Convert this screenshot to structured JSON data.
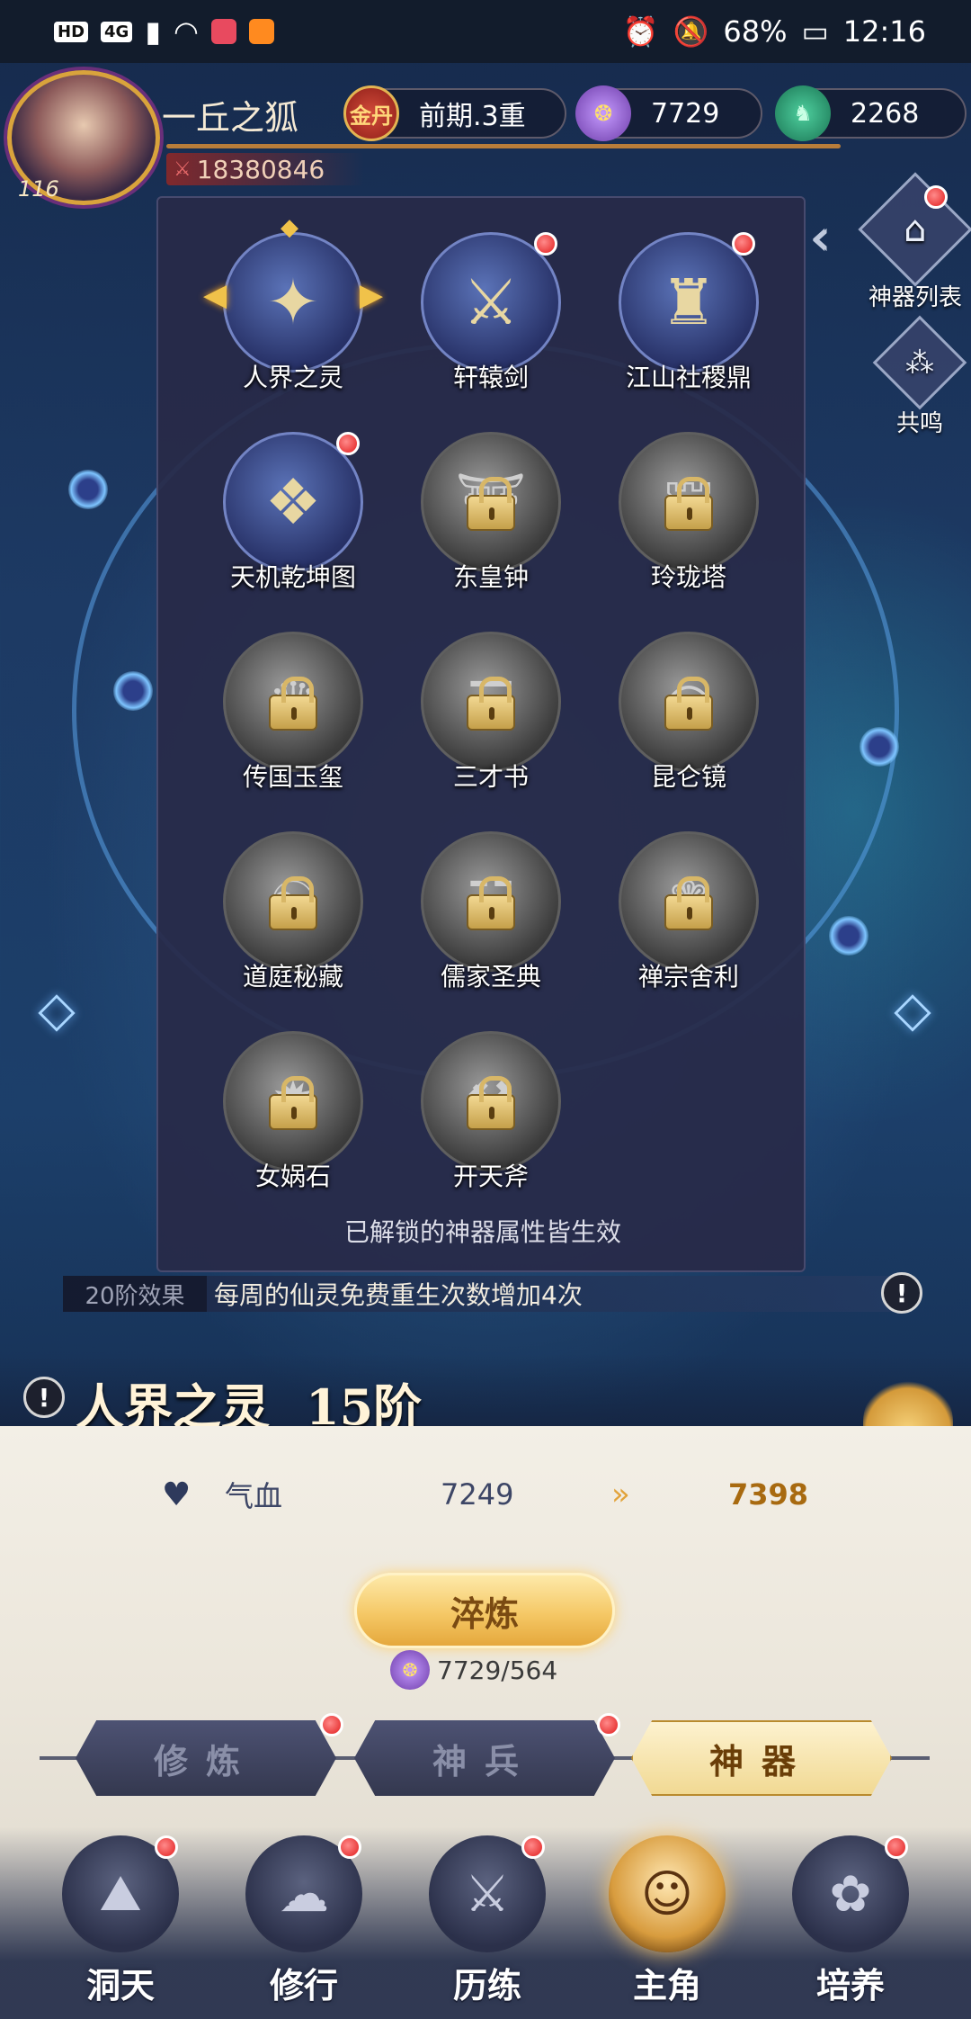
{
  "status_bar": {
    "left_chips": [
      "HD",
      "4G"
    ],
    "battery": "68%",
    "time": "12:16"
  },
  "player": {
    "name": "一丘之狐",
    "level": "116",
    "power": "18380846",
    "realm_badge": "金丹",
    "realm": "前期.3重",
    "currency1": "7729",
    "currency2": "2268"
  },
  "side": {
    "list_label": "神器列表",
    "resonance_label": "共鸣"
  },
  "artifacts": [
    {
      "name": "人界之灵",
      "locked": false,
      "dot": false,
      "selected": true,
      "icon": "✦"
    },
    {
      "name": "轩辕剑",
      "locked": false,
      "dot": true,
      "selected": false,
      "icon": "⚔"
    },
    {
      "name": "江山社稷鼎",
      "locked": false,
      "dot": true,
      "selected": false,
      "icon": "♜"
    },
    {
      "name": "天机乾坤图",
      "locked": false,
      "dot": true,
      "selected": false,
      "icon": "❖"
    },
    {
      "name": "东皇钟",
      "locked": true,
      "dot": false,
      "selected": false,
      "icon": "⛩"
    },
    {
      "name": "玲珑塔",
      "locked": true,
      "dot": false,
      "selected": false,
      "icon": "⛫"
    },
    {
      "name": "传国玉玺",
      "locked": true,
      "dot": false,
      "selected": false,
      "icon": "♛"
    },
    {
      "name": "三才书",
      "locked": true,
      "dot": false,
      "selected": false,
      "icon": "☰"
    },
    {
      "name": "昆仑镜",
      "locked": true,
      "dot": false,
      "selected": false,
      "icon": "◎"
    },
    {
      "name": "道庭秘藏",
      "locked": true,
      "dot": false,
      "selected": false,
      "icon": "☯"
    },
    {
      "name": "儒家圣典",
      "locked": true,
      "dot": false,
      "selected": false,
      "icon": "☷"
    },
    {
      "name": "禅宗舍利",
      "locked": true,
      "dot": false,
      "selected": false,
      "icon": "❁"
    },
    {
      "name": "女娲石",
      "locked": true,
      "dot": false,
      "selected": false,
      "icon": "✹"
    },
    {
      "name": "开天斧",
      "locked": true,
      "dot": false,
      "selected": false,
      "icon": "⚒"
    }
  ],
  "panel_note": "已解锁的神器属性皆生效",
  "effect": {
    "tag": "20阶效果",
    "text": "每周的仙灵免费重生次数增加4次"
  },
  "detail": {
    "name": "人界之灵",
    "stage": "15阶",
    "stat_name": "气血",
    "stat_current": "7249",
    "stat_next": "7398",
    "refine_label": "淬炼",
    "cost": "7729/564"
  },
  "tabs": [
    {
      "label": "修炼",
      "active": false,
      "dot": true
    },
    {
      "label": "神兵",
      "active": false,
      "dot": true
    },
    {
      "label": "神器",
      "active": true,
      "dot": false
    }
  ],
  "bottom_nav": [
    {
      "label": "洞天",
      "dot": true,
      "active": false,
      "icon": "⛰"
    },
    {
      "label": "修行",
      "dot": true,
      "active": false,
      "icon": "☁"
    },
    {
      "label": "历练",
      "dot": true,
      "active": false,
      "icon": "⚔"
    },
    {
      "label": "主角",
      "dot": false,
      "active": true,
      "icon": "☺"
    },
    {
      "label": "培养",
      "dot": true,
      "active": false,
      "icon": "✿"
    }
  ]
}
